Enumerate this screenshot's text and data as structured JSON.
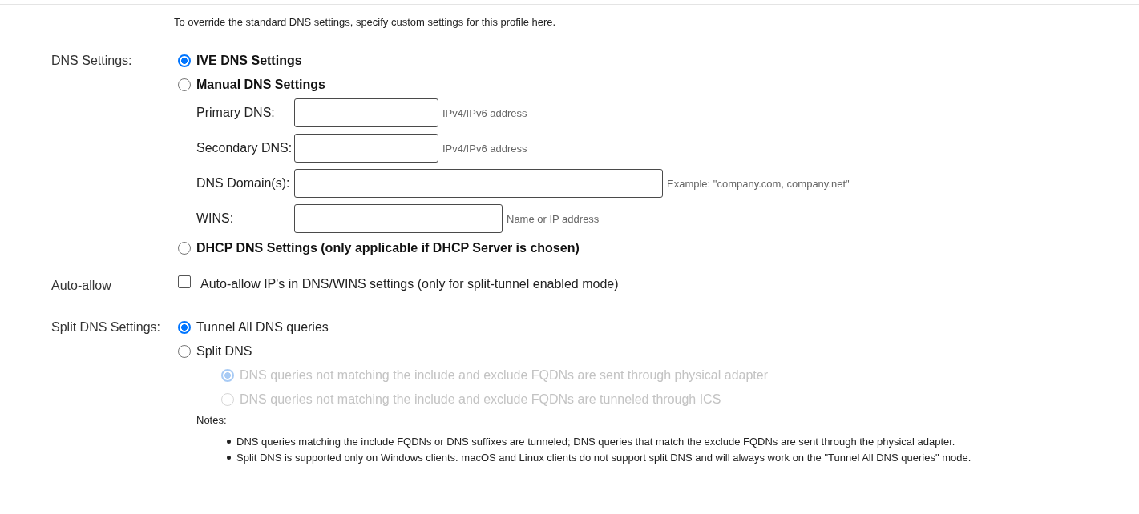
{
  "intro": "To override the standard DNS settings, specify custom settings for this profile here.",
  "dns_settings": {
    "label": "DNS Settings:",
    "options": [
      {
        "label": "IVE DNS Settings",
        "selected": true
      },
      {
        "label": "Manual DNS Settings",
        "selected": false,
        "fields": [
          {
            "label": "Primary DNS:",
            "kind": "address",
            "hint": "IPv4/IPv6 address"
          },
          {
            "label": "Secondary DNS:",
            "kind": "address",
            "hint": "IPv4/IPv6 address"
          },
          {
            "label": "DNS Domain(s):",
            "kind": "domains",
            "hint": "Example: \"company.com, company.net\""
          },
          {
            "label": "WINS:",
            "kind": "name",
            "hint": "Name or IP address"
          }
        ]
      },
      {
        "label": "DHCP DNS Settings (only applicable if DHCP Server is chosen)",
        "selected": false
      }
    ]
  },
  "auto_allow": {
    "label": "Auto-allow",
    "checkbox": {
      "label": "Auto-allow IP's in DNS/WINS settings (only for split-tunnel enabled mode)",
      "checked": false
    }
  },
  "split_dns": {
    "label": "Split DNS Settings:",
    "options": [
      {
        "label": "Tunnel All DNS queries",
        "selected": true
      },
      {
        "label": "Split DNS",
        "selected": false,
        "sub_options": [
          {
            "label": "DNS queries not matching the include and exclude FQDNs are sent through physical adapter",
            "selected": true,
            "disabled": true
          },
          {
            "label": "DNS queries not matching the include and exclude FQDNs are tunneled through ICS",
            "selected": false,
            "disabled": true
          }
        ]
      }
    ],
    "notes": {
      "title": "Notes:",
      "items": [
        "DNS queries matching the include FQDNs or DNS suffixes are tunneled; DNS queries that match the exclude FQDNs are sent through the physical adapter.",
        "Split DNS is supported only on Windows clients. macOS and Linux clients do not support split DNS and will always work on the \"Tunnel All DNS queries\" mode."
      ]
    }
  }
}
